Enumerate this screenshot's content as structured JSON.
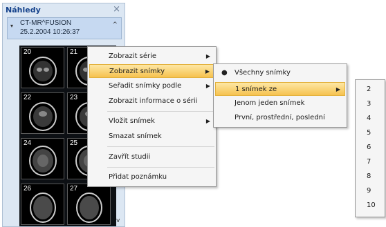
{
  "panel": {
    "title": "Náhledy",
    "close_glyph": "×",
    "study": {
      "name": "CT-MR^FUSION",
      "date": "25.2.2004 10:26:37",
      "expand_glyph": "▾",
      "collapse_glyph": "^"
    },
    "thumbnails": [
      "20",
      "21",
      "22",
      "23",
      "24",
      "25",
      "26",
      "27"
    ],
    "scroll_glyph": "v"
  },
  "context_menu": {
    "items": [
      {
        "label": "Zobrazit série",
        "submenu": true
      },
      {
        "label": "Zobrazit snímky",
        "submenu": true,
        "highlighted": true
      },
      {
        "label": "Seřadit snímky podle",
        "submenu": true
      },
      {
        "label": "Zobrazit informace o sérii",
        "submenu": false
      },
      {
        "label": "Vložit snímek",
        "submenu": true
      },
      {
        "label": "Smazat snímek",
        "submenu": false
      },
      {
        "label": "Zavřít studii",
        "submenu": false
      },
      {
        "label": "Přidat poznámku",
        "submenu": false
      }
    ],
    "arrow_glyph": "▶"
  },
  "submenu_images": {
    "items": [
      {
        "label": "Všechny snímky",
        "selected": true
      },
      {
        "label": "1 snímek ze",
        "submenu": true,
        "highlighted": true
      },
      {
        "label": "Jenom jeden snímek"
      },
      {
        "label": "První, prostřední, poslední"
      }
    ],
    "bullet_glyph": "●"
  },
  "submenu_every": {
    "items": [
      "2",
      "3",
      "4",
      "5",
      "6",
      "7",
      "8",
      "9",
      "10"
    ]
  },
  "colors": {
    "panel_bg": "#dce7f3",
    "highlight": "#f6c24f",
    "title": "#15428b"
  }
}
